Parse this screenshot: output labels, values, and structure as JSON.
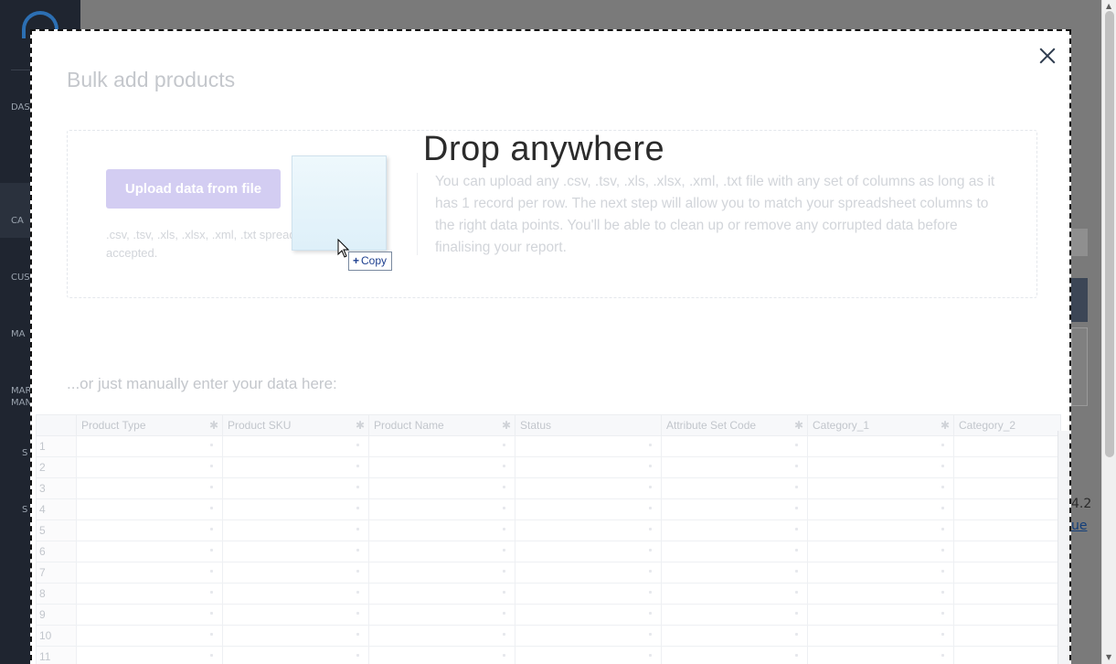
{
  "background": {
    "nav_items": [
      "DAS",
      "CA",
      "CUS",
      "MA",
      "MAR",
      "MAN",
      "S",
      "S"
    ],
    "right_text": "4.2",
    "right_link": "ue"
  },
  "modal": {
    "title": "Bulk add products",
    "upload_button": "Upload data from file",
    "upload_hint": ".csv, .tsv, .xls, .xlsx, .xml, .txt spreadsheets accepted.",
    "upload_description": "You can upload any .csv, .tsv, .xls, .xlsx, .xml, .txt file with any set of columns as long as it has 1 record per row. The next step will allow you to match your spreadsheet columns to the right data points. You'll be able to clean up or remove any corrupted data before finalising your report.",
    "drop_overlay": "Drop anywhere",
    "copy_badge": "Copy",
    "manual_label": "...or just manually enter your data here:"
  },
  "grid": {
    "columns": [
      {
        "label": "Product Type",
        "required": true
      },
      {
        "label": "Product SKU",
        "required": true
      },
      {
        "label": "Product Name",
        "required": true
      },
      {
        "label": "Status",
        "required": false
      },
      {
        "label": "Attribute Set Code",
        "required": true
      },
      {
        "label": "Category_1",
        "required": true
      },
      {
        "label": "Category_2",
        "required": false
      }
    ],
    "rows": [
      "1",
      "2",
      "3",
      "4",
      "5",
      "6",
      "7",
      "8",
      "9",
      "10",
      "11"
    ]
  },
  "colors": {
    "accent": "#d3cdf2",
    "sidebar": "#1f2530",
    "copy_text": "#1d3f8f"
  }
}
